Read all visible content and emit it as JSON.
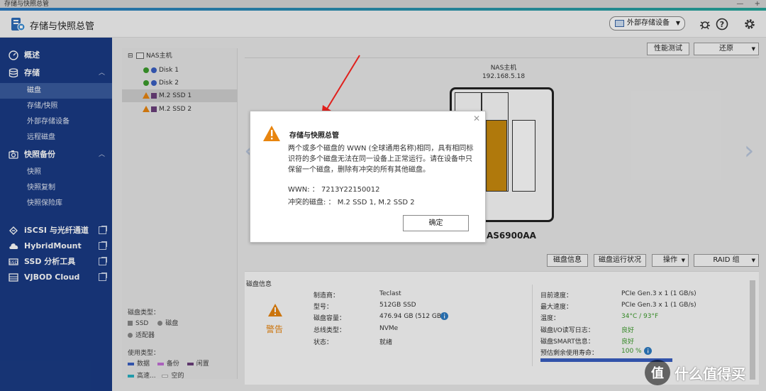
{
  "window": {
    "title": "存储与快照总管",
    "controls": [
      "—",
      "+"
    ]
  },
  "header": {
    "app_title": "存储与快照总管",
    "external_storage_btn": "外部存储设备",
    "icons": [
      "bug-icon",
      "help-icon",
      "gear-icon"
    ]
  },
  "sidebar": {
    "overview": "概述",
    "storage": "存储",
    "storage_sub": [
      "磁盘",
      "存储/快照",
      "外部存储设备",
      "远程磁盘"
    ],
    "backup": "快照备份",
    "backup_sub": [
      "快照",
      "快照复制",
      "快照保险库"
    ],
    "apps": [
      "iSCSI 与光纤通道",
      "HybridMount",
      "SSD 分析工具",
      "VJBOD Cloud"
    ]
  },
  "tree": {
    "root": "NAS主机",
    "disks": [
      {
        "name": "Disk 1",
        "status": "ok"
      },
      {
        "name": "Disk 2",
        "status": "ok"
      },
      {
        "name": "M.2 SSD 1",
        "status": "warning"
      },
      {
        "name": "M.2 SSD 2",
        "status": "warning"
      }
    ]
  },
  "legend": {
    "disk_type_title": "磁盘类型：",
    "disk_types": [
      "SSD",
      "磁盘",
      "适配器"
    ],
    "usage_type_title": "使用类型：",
    "usage_types": [
      {
        "label": "数据",
        "color": "#3a5fc2"
      },
      {
        "label": "备份",
        "color": "#c36fd6"
      },
      {
        "label": "闲置",
        "color": "#6a3f7a"
      },
      {
        "label": "高速...",
        "color": "#26b0c2"
      },
      {
        "label": "空的",
        "color": "#ffffff"
      }
    ]
  },
  "main": {
    "perf_test_btn": "性能测试",
    "restore_btn": "还原",
    "nas_name": "NAS主机",
    "nas_ip": "192.168.5.18",
    "model_partial": "AS6900AA",
    "tabs": [
      "磁盘信息",
      "磁盘运行状况",
      "操作",
      "RAID 组"
    ]
  },
  "disk_info": {
    "title": "磁盘信息",
    "status_label": "警告",
    "left": [
      {
        "key": "制造商：",
        "value": "Teclast"
      },
      {
        "key": "型号：",
        "value": "512GB SSD"
      },
      {
        "key": "磁盘容量：",
        "value": "476.94 GB (512 GB)"
      },
      {
        "key": "总线类型：",
        "value": "NVMe"
      },
      {
        "key": "状态：",
        "value": "就绪"
      }
    ],
    "right": [
      {
        "key": "目前速度：",
        "value": "PCIe Gen.3 x 1 (1 GB/s)"
      },
      {
        "key": "最大速度：",
        "value": "PCIe Gen.3 x 1 (1 GB/s)"
      },
      {
        "key": "温度：",
        "value": "34°C / 93°F"
      },
      {
        "key": "磁盘I/O读写日志：",
        "value": "良好"
      },
      {
        "key": "磁盘SMART信息：",
        "value": "良好"
      },
      {
        "key": "预估剩余使用寿命：",
        "value": "100 %"
      }
    ],
    "life_percent": 100
  },
  "dialog": {
    "title": "存储与快照总管",
    "message": "两个或多个磁盘的 WWN (全球通用名称)相同，具有相同标识符的多个磁盘无法在同一设备上正常运行。请在设备中只保留一个磁盘，删除有冲突的所有其他磁盘。",
    "wwn": "WWN: ：  7213Y22150012",
    "conflict": "冲突的磁盘: ：  M.2 SSD 1, M.2 SSD 2",
    "ok": "确定"
  },
  "watermark": {
    "logo_char": "值",
    "text": "什么值得买"
  }
}
